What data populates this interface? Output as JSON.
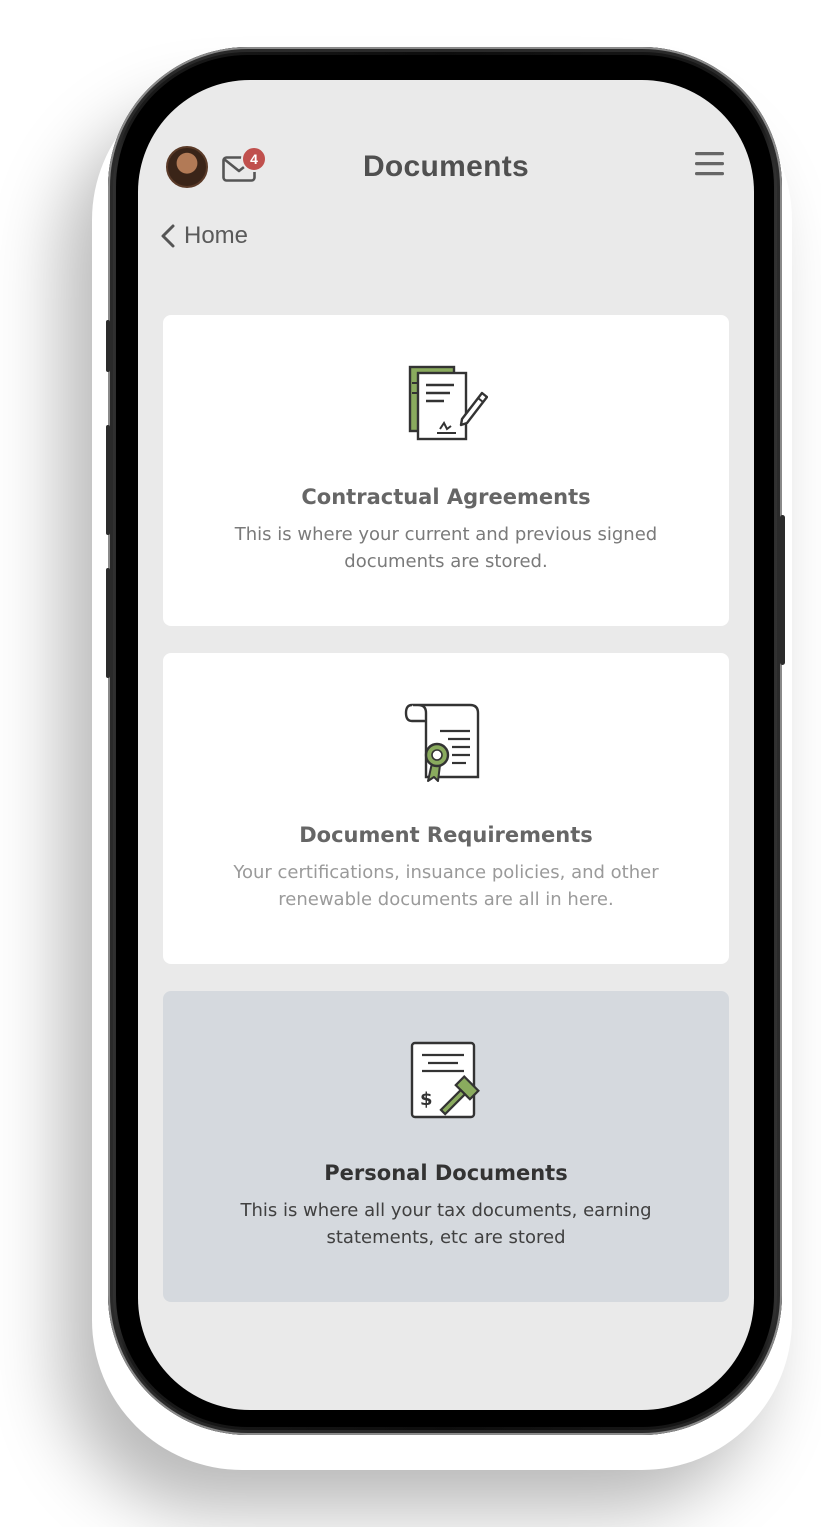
{
  "header": {
    "title": "Documents",
    "unread_count": "4",
    "avatar_icon": "user-avatar",
    "mail_icon": "envelope-icon",
    "menu_icon": "hamburger-menu-icon"
  },
  "nav": {
    "back_label": "Home"
  },
  "cards": [
    {
      "title": "Contractual Agreements",
      "description": "This is where your current and previous signed documents are stored.",
      "icon": "contract-signing-icon"
    },
    {
      "title": "Document Requirements",
      "description": "Your certifications, insuance policies, and other renewable documents are all in here.",
      "icon": "certificate-scroll-icon"
    },
    {
      "title": "Personal Documents",
      "description": "This is where all your tax documents, earning statements, etc are stored",
      "icon": "legal-tax-document-icon",
      "selected": true
    }
  ],
  "colors": {
    "accent_green": "#8aab5e",
    "badge_red": "#c0504d",
    "screen_bg": "#eaeaea",
    "selected_card_bg": "#d5d9de"
  }
}
